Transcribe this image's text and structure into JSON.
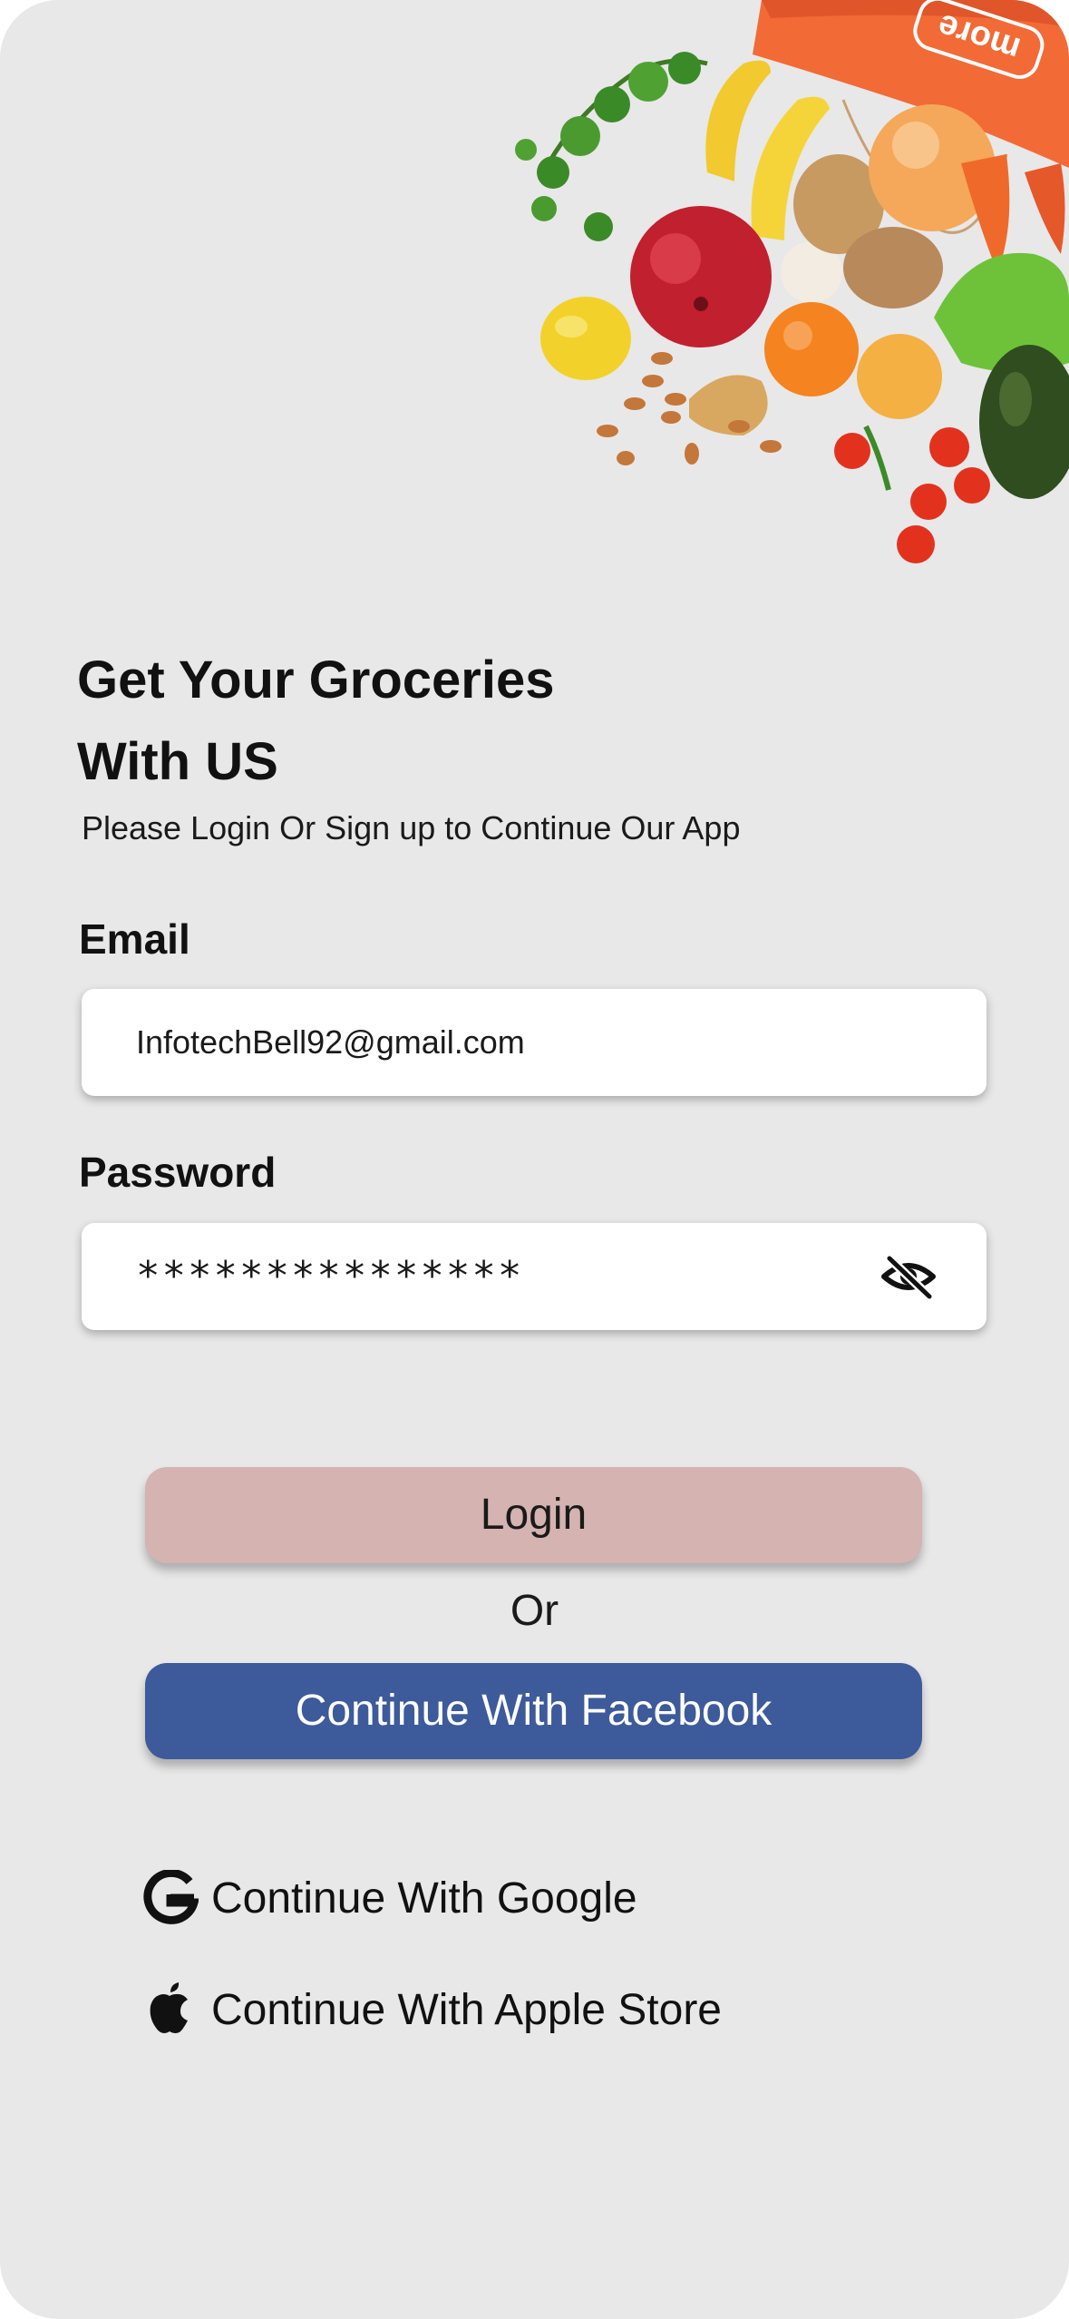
{
  "header": {
    "title_line1": "Get Your Groceries",
    "title_line2": "With US",
    "subtitle": "Please Login Or Sign up to Continue Our App",
    "bag_brand": "more"
  },
  "form": {
    "email_label": "Email",
    "email_value": "InfotechBell92@gmail.com",
    "password_label": "Password",
    "password_value": "***************",
    "password_toggle_icon": "eye-slash-icon"
  },
  "actions": {
    "login_label": "Login",
    "or_label": "Or",
    "facebook_label": "Continue With Facebook",
    "google_label": "Continue With Google",
    "apple_label": "Continue With Apple Store"
  },
  "colors": {
    "background": "#e8e8e8",
    "login_button": "#d4b3b1",
    "facebook_button": "#3d5a9b",
    "bag": "#f26a36"
  }
}
